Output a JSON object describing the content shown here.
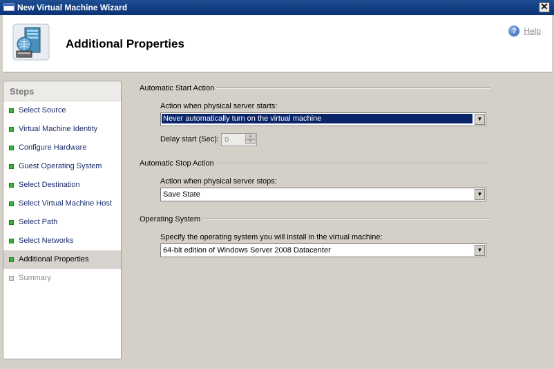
{
  "window": {
    "title": "New Virtual Machine Wizard"
  },
  "header": {
    "page_title": "Additional Properties",
    "help_label": "Help"
  },
  "sidebar": {
    "heading": "Steps",
    "items": [
      {
        "label": "Select Source",
        "state": "done"
      },
      {
        "label": "Virtual Machine Identity",
        "state": "done"
      },
      {
        "label": "Configure Hardware",
        "state": "done"
      },
      {
        "label": "Guest Operating System",
        "state": "done"
      },
      {
        "label": "Select Destination",
        "state": "done"
      },
      {
        "label": "Select Virtual Machine Host",
        "state": "done"
      },
      {
        "label": "Select Path",
        "state": "done"
      },
      {
        "label": "Select Networks",
        "state": "done"
      },
      {
        "label": "Additional Properties",
        "state": "current"
      },
      {
        "label": "Summary",
        "state": "pending"
      }
    ]
  },
  "start_action": {
    "heading": "Automatic Start Action",
    "label": "Action when physical server starts:",
    "value": "Never automatically turn on the virtual machine",
    "delay_label": "Delay start (Sec):",
    "delay_value": "0"
  },
  "stop_action": {
    "heading": "Automatic Stop Action",
    "label": "Action when physical server stops:",
    "value": "Save State"
  },
  "operating_system": {
    "heading": "Operating System",
    "label": "Specify the operating system you will install in the virtual machine:",
    "value": "64-bit edition of Windows Server 2008 Datacenter"
  },
  "colors": {
    "title_bar": "#0b3275",
    "selection": "#0a246a",
    "step_bullet": "#3cb43c"
  }
}
